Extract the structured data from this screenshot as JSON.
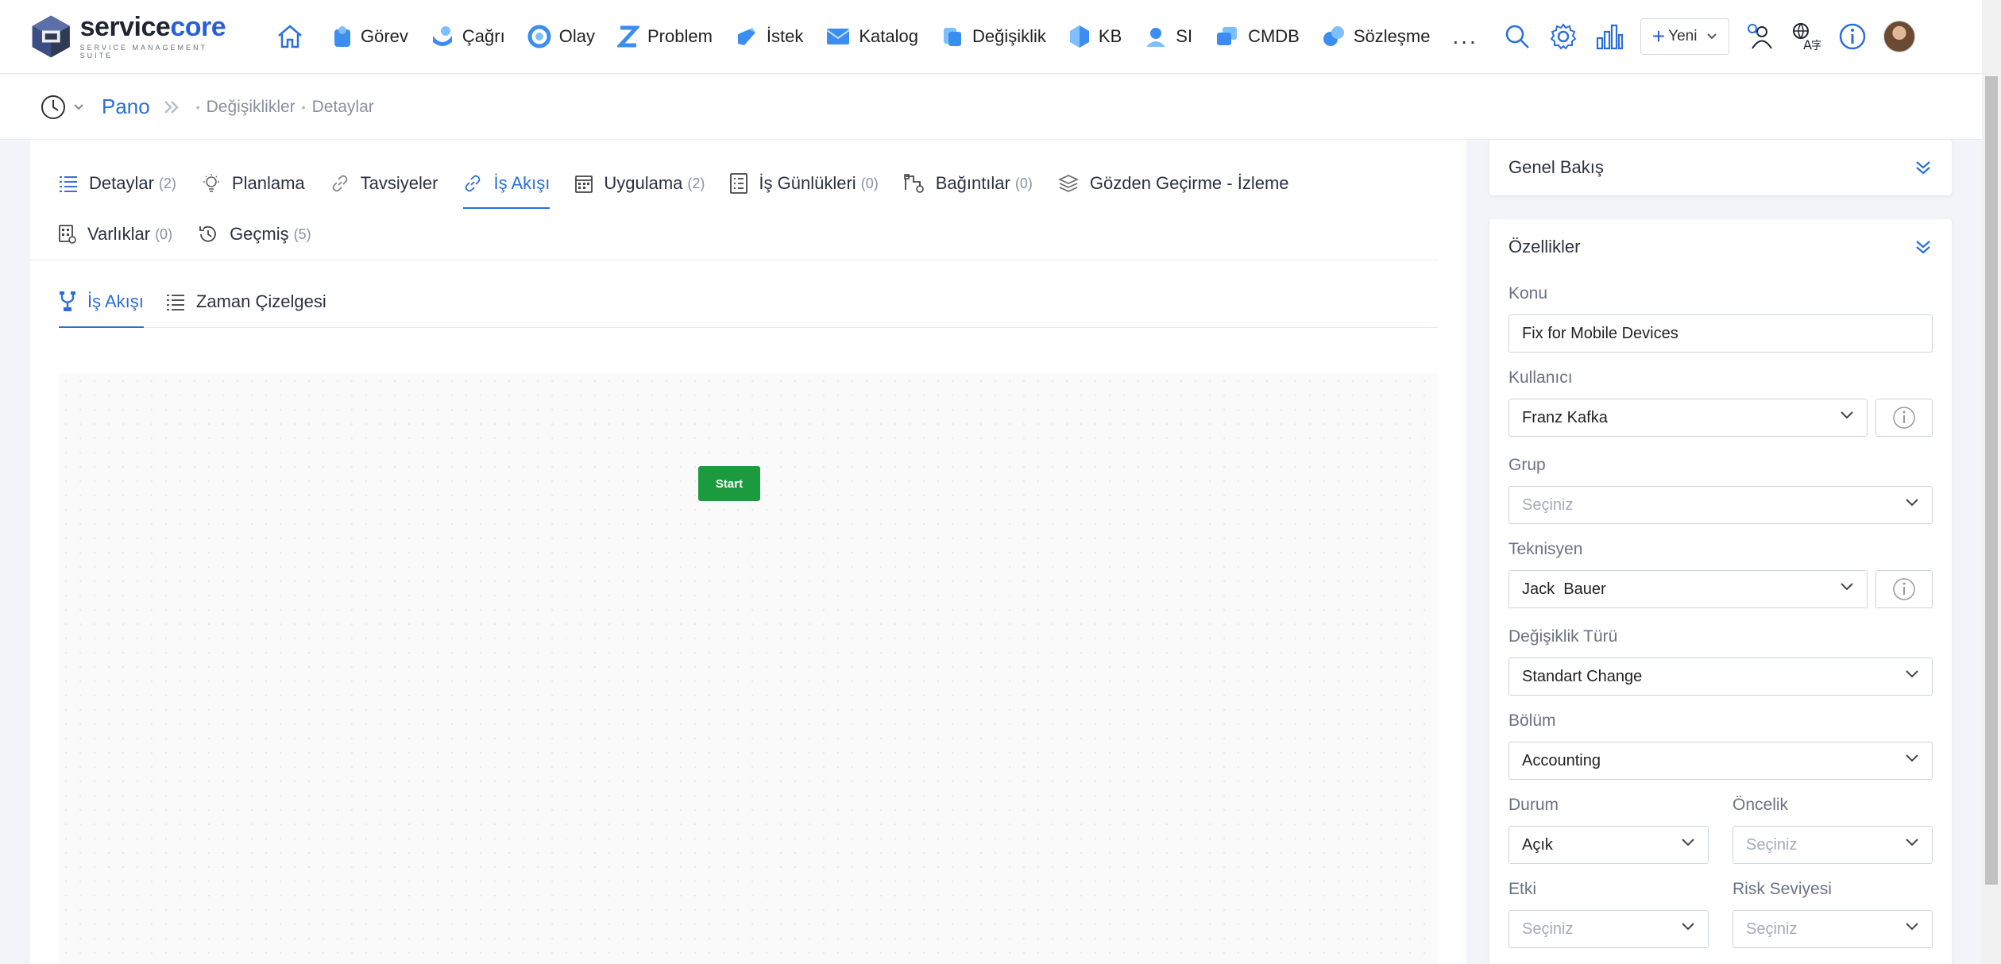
{
  "brand": {
    "name_part1": "service",
    "name_part2": "core",
    "subtitle": "SERVICE MANAGEMENT SUITE"
  },
  "nav": {
    "items": [
      {
        "label": "Görev",
        "icon": "task-icon"
      },
      {
        "label": "Çağrı",
        "icon": "call-icon"
      },
      {
        "label": "Olay",
        "icon": "incident-icon"
      },
      {
        "label": "Problem",
        "icon": "problem-icon"
      },
      {
        "label": "İstek",
        "icon": "request-icon"
      },
      {
        "label": "Katalog",
        "icon": "catalog-icon"
      },
      {
        "label": "Değişiklik",
        "icon": "change-icon"
      },
      {
        "label": "KB",
        "icon": "kb-icon"
      },
      {
        "label": "SI",
        "icon": "si-icon"
      },
      {
        "label": "CMDB",
        "icon": "cmdb-icon"
      },
      {
        "label": "Sözleşme",
        "icon": "contract-icon"
      }
    ],
    "more": "...",
    "new_label": "Yeni"
  },
  "breadcrumb": {
    "home": "Pano",
    "items": [
      "Değişiklikler",
      "Detaylar"
    ]
  },
  "tabs": [
    {
      "label": "Detaylar",
      "count": "(2)"
    },
    {
      "label": "Planlama",
      "count": ""
    },
    {
      "label": "Tavsiyeler",
      "count": ""
    },
    {
      "label": "İş Akışı",
      "count": ""
    },
    {
      "label": "Uygulama",
      "count": "(2)"
    },
    {
      "label": "İş Günlükleri",
      "count": "(0)"
    },
    {
      "label": "Bağıntılar",
      "count": "(0)"
    },
    {
      "label": "Gözden Geçirme - İzleme",
      "count": ""
    },
    {
      "label": "Varlıklar",
      "count": "(0)"
    },
    {
      "label": "Geçmiş",
      "count": "(5)"
    }
  ],
  "subtabs": [
    {
      "label": "İş Akışı"
    },
    {
      "label": "Zaman Çizelgesi"
    }
  ],
  "workflow": {
    "start_label": "Start"
  },
  "overview": {
    "title": "Genel Bakış"
  },
  "properties": {
    "title": "Özellikler",
    "subject": {
      "label": "Konu",
      "value": "Fix for Mobile Devices"
    },
    "user": {
      "label": "Kullanıcı",
      "value": "Franz Kafka"
    },
    "group": {
      "label": "Grup",
      "placeholder": "Seçiniz"
    },
    "technician": {
      "label": "Teknisyen",
      "value": "Jack  Bauer"
    },
    "change_type": {
      "label": "Değişiklik Türü",
      "value": "Standart Change"
    },
    "department": {
      "label": "Bölüm",
      "value": "Accounting"
    },
    "status": {
      "label": "Durum",
      "value": "Açık"
    },
    "priority": {
      "label": "Öncelik",
      "placeholder": "Seçiniz"
    },
    "impact": {
      "label": "Etki",
      "placeholder": "Seçiniz"
    },
    "risk": {
      "label": "Risk Seviyesi",
      "placeholder": "Seçiniz"
    }
  },
  "colors": {
    "accent": "#2a6fd8",
    "start_node": "#1b9b3e"
  }
}
